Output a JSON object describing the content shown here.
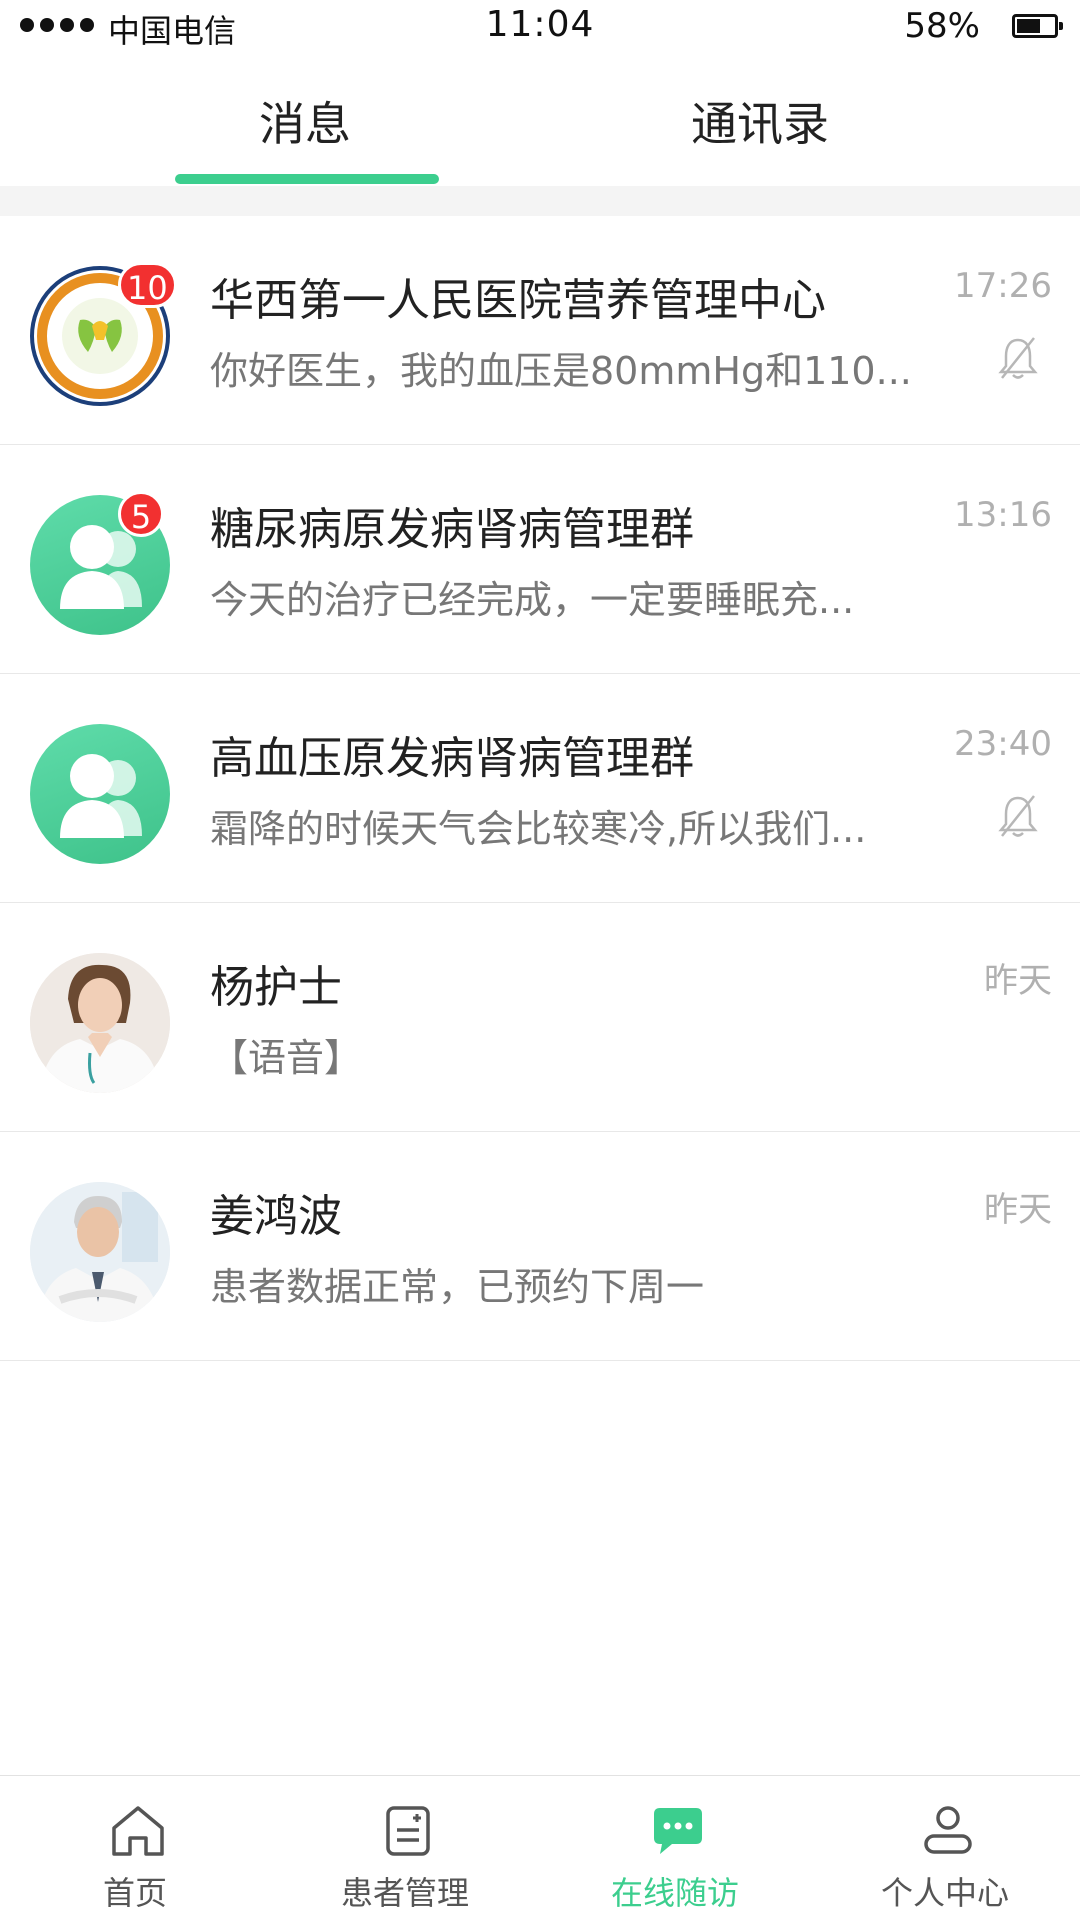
{
  "status_bar": {
    "carrier": "中国电信",
    "time": "11:04",
    "battery": "58%"
  },
  "tabs": [
    {
      "label": "消息",
      "active": true
    },
    {
      "label": "通讯录",
      "active": false
    }
  ],
  "conversations": [
    {
      "title": "华西第一人民医院营养管理中心",
      "preview": "你好医生，我的血压是80mmHg和110...",
      "time": "17:26",
      "badge": "10",
      "muted": true,
      "avatar": "hospital-logo"
    },
    {
      "title": "糖尿病原发病肾病管理群",
      "preview": "今天的治疗已经完成，一定要睡眠充...",
      "time": "13:16",
      "badge": "5",
      "muted": false,
      "avatar": "group-icon"
    },
    {
      "title": "高血压原发病肾病管理群",
      "preview": "霜降的时候天气会比较寒冷,所以我们...",
      "time": "23:40",
      "badge": "",
      "muted": true,
      "avatar": "group-icon"
    },
    {
      "title": "杨护士",
      "preview": "【语音】",
      "time": "昨天",
      "badge": "",
      "muted": false,
      "avatar": "nurse-photo"
    },
    {
      "title": "姜鸿波",
      "preview": "患者数据正常，已预约下周一",
      "time": "昨天",
      "badge": "",
      "muted": false,
      "avatar": "doctor-photo"
    }
  ],
  "tabbar": [
    {
      "label": "首页",
      "icon": "home-icon",
      "active": false
    },
    {
      "label": "患者管理",
      "icon": "patient-management-icon",
      "active": false
    },
    {
      "label": "在线随访",
      "icon": "chat-icon",
      "active": true
    },
    {
      "label": "个人中心",
      "icon": "profile-icon",
      "active": false
    }
  ],
  "colors": {
    "accent": "#3cce8e",
    "badge": "#f23030"
  }
}
